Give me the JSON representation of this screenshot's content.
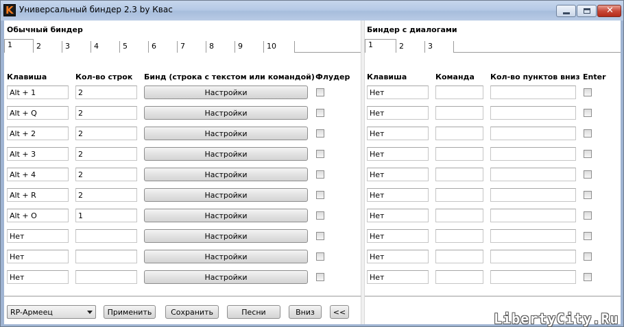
{
  "window": {
    "title": "Универсальный биндер 2.3 by Квас",
    "icon_letter": "K"
  },
  "left": {
    "group_title": "Обычный биндер",
    "tabs": [
      "1",
      "2",
      "3",
      "4",
      "5",
      "6",
      "7",
      "8",
      "9",
      "10"
    ],
    "active_tab": "1",
    "headers": {
      "key": "Клавиша",
      "lines": "Кол-во строк",
      "bind": "Бинд (строка с текстом или командой)",
      "flood": "Флудер"
    },
    "rows": [
      {
        "key": "Alt + 1",
        "lines": "2",
        "bind_label": "Настройки",
        "flood": false
      },
      {
        "key": "Alt + Q",
        "lines": "2",
        "bind_label": "Настройки",
        "flood": false
      },
      {
        "key": "Alt + 2",
        "lines": "2",
        "bind_label": "Настройки",
        "flood": false
      },
      {
        "key": "Alt + 3",
        "lines": "2",
        "bind_label": "Настройки",
        "flood": false
      },
      {
        "key": "Alt + 4",
        "lines": "2",
        "bind_label": "Настройки",
        "flood": false
      },
      {
        "key": "Alt + R",
        "lines": "2",
        "bind_label": "Настройки",
        "flood": false
      },
      {
        "key": "Alt + O",
        "lines": "1",
        "bind_label": "Настройки",
        "flood": false
      },
      {
        "key": "Нет",
        "lines": "",
        "bind_label": "Настройки",
        "flood": false
      },
      {
        "key": "Нет",
        "lines": "",
        "bind_label": "Настройки",
        "flood": false
      },
      {
        "key": "Нет",
        "lines": "",
        "bind_label": "Настройки",
        "flood": false
      }
    ]
  },
  "right": {
    "group_title": "Биндер с диалогами",
    "tabs": [
      "1",
      "2",
      "3"
    ],
    "active_tab": "1",
    "headers": {
      "key": "Клавиша",
      "command": "Команда",
      "items_down": "Кол-во пунктов вниз",
      "enter": "Enter"
    },
    "rows": [
      {
        "key": "Нет",
        "command": "",
        "items_down": "",
        "enter": false
      },
      {
        "key": "Нет",
        "command": "",
        "items_down": "",
        "enter": false
      },
      {
        "key": "Нет",
        "command": "",
        "items_down": "",
        "enter": false
      },
      {
        "key": "Нет",
        "command": "",
        "items_down": "",
        "enter": false
      },
      {
        "key": "Нет",
        "command": "",
        "items_down": "",
        "enter": false
      },
      {
        "key": "Нет",
        "command": "",
        "items_down": "",
        "enter": false
      },
      {
        "key": "Нет",
        "command": "",
        "items_down": "",
        "enter": false
      },
      {
        "key": "Нет",
        "command": "",
        "items_down": "",
        "enter": false
      },
      {
        "key": "Нет",
        "command": "",
        "items_down": "",
        "enter": false
      },
      {
        "key": "Нет",
        "command": "",
        "items_down": "",
        "enter": false
      }
    ]
  },
  "footer": {
    "profile_select": "RP-Армеец",
    "apply": "Применить",
    "save": "Сохранить",
    "songs": "Песни",
    "down": "Вниз",
    "collapse": "<<"
  },
  "watermark": "LibertyCity.Ru"
}
